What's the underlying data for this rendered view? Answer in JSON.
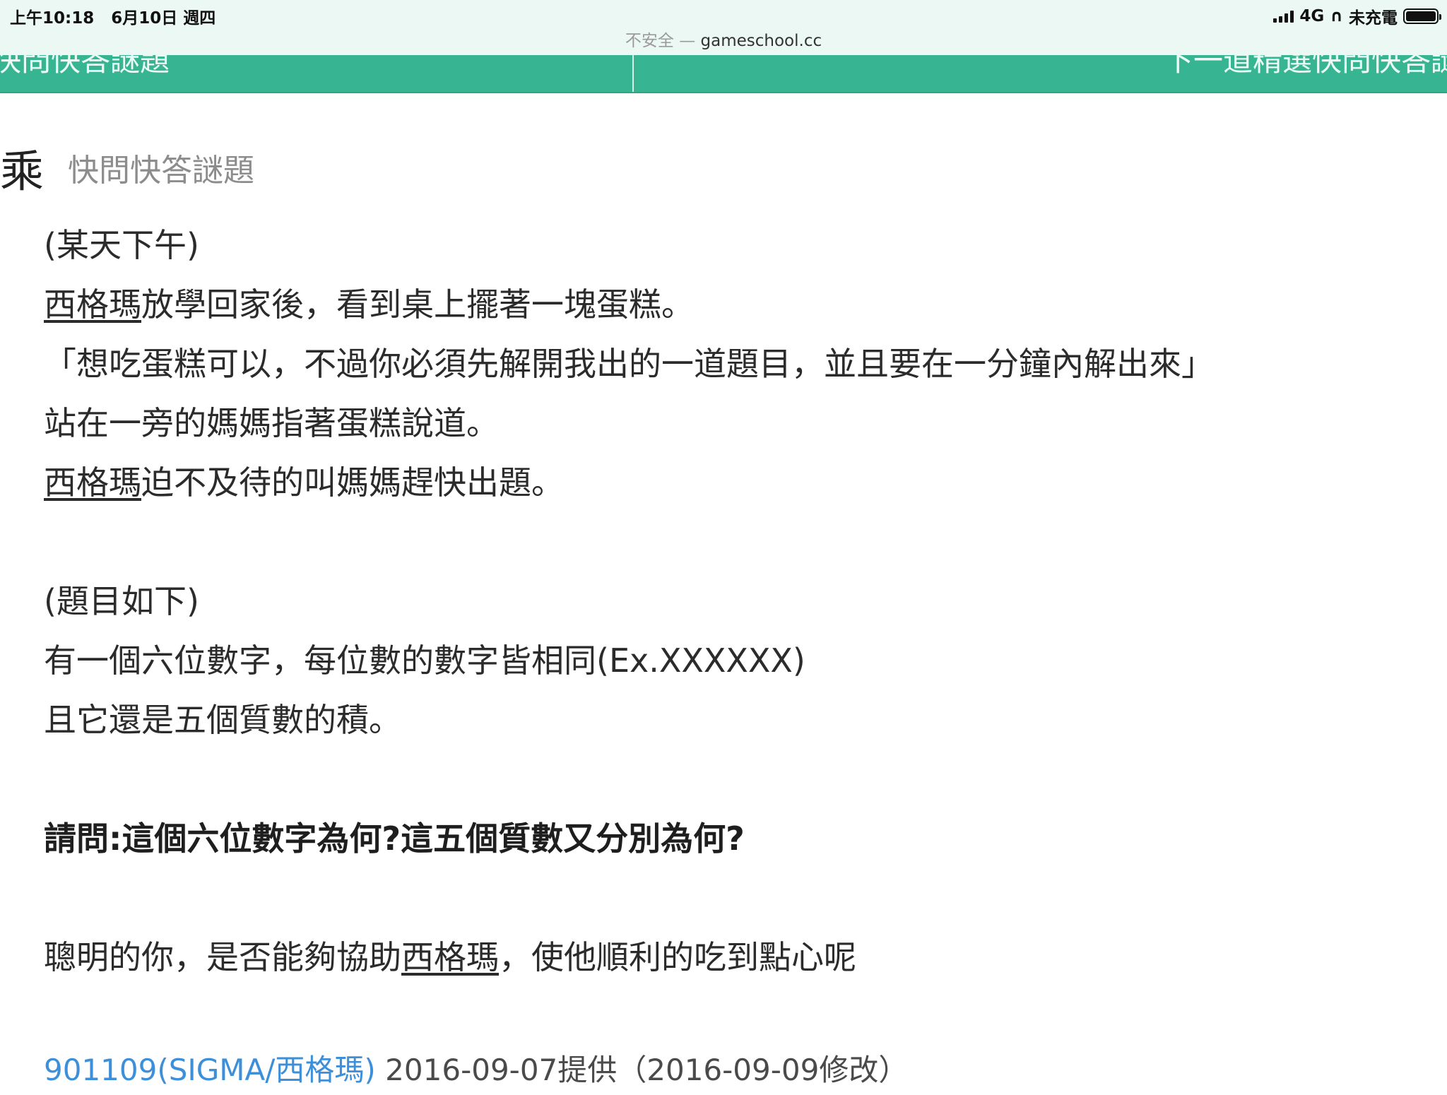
{
  "status_bar": {
    "time": "上午10:18",
    "date": "6月10日 週四",
    "network": "4G",
    "charging": "未充電",
    "url_insecure": "不安全 —",
    "url_domain": "gameschool.cc"
  },
  "nav": {
    "prev_label": "快問快答謎題",
    "next_label": "下一道精選快問快答謎"
  },
  "header": {
    "title_char": "乘",
    "category": "快問快答謎題"
  },
  "story": {
    "l1": "(某天下午)",
    "l2_name": "西格瑪",
    "l2_rest": "放學回家後，看到桌上擺著一塊蛋糕。",
    "l3": "「想吃蛋糕可以，不過你必須先解開我出的一道題目，並且要在一分鐘內解出來」",
    "l4": "站在一旁的媽媽指著蛋糕說道。",
    "l5_name": "西格瑪",
    "l5_rest": "迫不及待的叫媽媽趕快出題。",
    "l6": "(題目如下)",
    "l7": "有一個六位數字，每位數的數字皆相同(Ex.XXXXXX)",
    "l8": "且它還是五個質數的積。",
    "question": "請問:這個六位數字為何?這五個質數又分別為何?",
    "closing_a": "聰明的你，是否能夠協助",
    "closing_name": "西格瑪",
    "closing_b": "，使他順利的吃到點心呢"
  },
  "footer": {
    "author": "901109(SIGMA/西格瑪)",
    "meta": " 2016-09-07提供（2016-09-09修改）"
  },
  "colors": {
    "nav_bg": "#37b592",
    "status_bg": "#ebf8f3",
    "link": "#3d8fd9"
  }
}
